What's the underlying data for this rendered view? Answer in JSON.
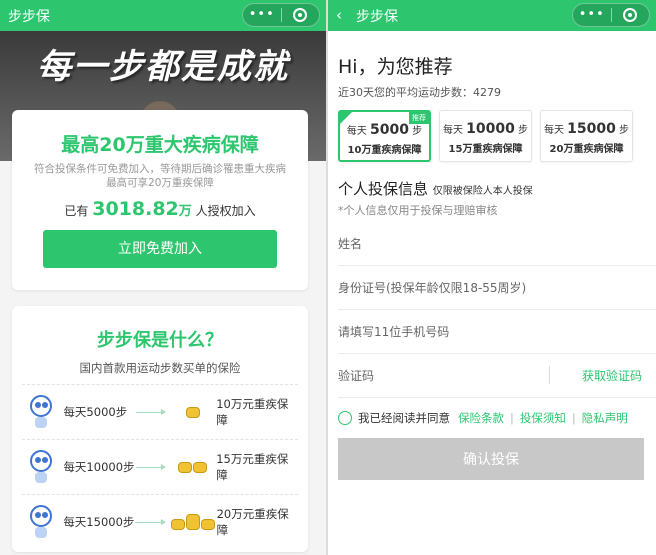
{
  "app": {
    "title": "步步保",
    "capsule_more": "•••"
  },
  "left": {
    "hero_slogan": "每一步都是成就",
    "card1": {
      "headline": "最高20万重大疾病保障",
      "desc_line1": "符合投保条件可免费加入，等待期后确诊罹患重大疾病",
      "desc_line2": "最高可享20万重疾保障",
      "joined_prefix": "已有",
      "joined_number": "3018.82",
      "joined_unit": "万",
      "joined_suffix": "人授权加入",
      "join_button": "立即免费加入"
    },
    "card2": {
      "title": "步步保是什么？",
      "subtitle": "国内首款用运动步数买单的保险",
      "rows": [
        {
          "steps": "每天5000步",
          "coverage": "10万元重疾保障"
        },
        {
          "steps": "每天10000步",
          "coverage": "15万元重疾保障"
        },
        {
          "steps": "每天15000步",
          "coverage": "20万元重疾保障"
        }
      ]
    }
  },
  "right": {
    "back_icon": "‹",
    "greeting": "Hi，为您推荐",
    "avg_steps": "近30天您的平均运动步数：4279",
    "plans": [
      {
        "prefix": "每天",
        "steps": "5000",
        "unit": "步",
        "coverage": "10万重疾病保障",
        "tag": "推荐"
      },
      {
        "prefix": "每天",
        "steps": "10000",
        "unit": "步",
        "coverage": "15万重疾病保障"
      },
      {
        "prefix": "每天",
        "steps": "15000",
        "unit": "步",
        "coverage": "20万重疾病保障"
      }
    ],
    "section_title": "个人投保信息",
    "section_note": "仅限被保险人本人投保",
    "privacy_note": "*个人信息仅用于投保与理赔审核",
    "fields": {
      "name": "姓名",
      "id": "身份证号(投保年龄仅限18-55周岁)",
      "phone": "请填写11位手机号码",
      "code": "验证码"
    },
    "get_code": "获取验证码",
    "agree_text": "我已经阅读并同意",
    "links": [
      "保险条款",
      "投保须知",
      "隐私声明"
    ],
    "link_sep": "|",
    "submit": "确认投保"
  },
  "colors": {
    "brand": "#2dc66f",
    "disabled": "#c8c8c8"
  }
}
